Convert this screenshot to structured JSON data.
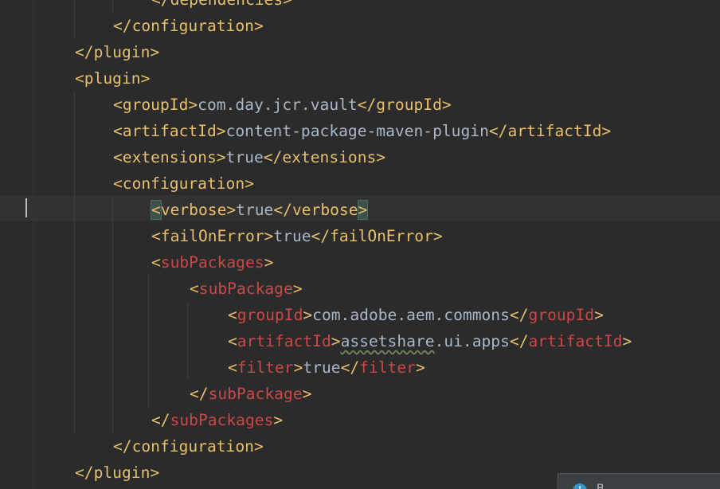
{
  "editor": {
    "language": "xml",
    "lines": [
      {
        "indent": 4,
        "tokens": [
          {
            "t": "</dependencies>",
            "c": "tag"
          }
        ]
      },
      {
        "indent": 3,
        "tokens": [
          {
            "t": "</configuration>",
            "c": "tag"
          }
        ]
      },
      {
        "indent": 2,
        "tokens": [
          {
            "t": "</plugin>",
            "c": "tag"
          }
        ]
      },
      {
        "indent": 2,
        "tokens": [
          {
            "t": "<plugin>",
            "c": "tag"
          }
        ]
      },
      {
        "indent": 3,
        "tokens": [
          {
            "t": "<groupId>",
            "c": "tag"
          },
          {
            "t": "com.day.jcr.vault",
            "c": "text"
          },
          {
            "t": "</groupId>",
            "c": "tag"
          }
        ]
      },
      {
        "indent": 3,
        "tokens": [
          {
            "t": "<artifactId>",
            "c": "tag"
          },
          {
            "t": "content-package-maven-plugin",
            "c": "text"
          },
          {
            "t": "</artifactId>",
            "c": "tag"
          }
        ]
      },
      {
        "indent": 3,
        "tokens": [
          {
            "t": "<extensions>",
            "c": "tag"
          },
          {
            "t": "true",
            "c": "text"
          },
          {
            "t": "</extensions>",
            "c": "tag"
          }
        ]
      },
      {
        "indent": 3,
        "tokens": [
          {
            "t": "<configuration>",
            "c": "tag"
          }
        ]
      },
      {
        "indent": 4,
        "current": true,
        "tokens": [
          {
            "t": "<",
            "c": "tag match"
          },
          {
            "t": "verbose>",
            "c": "tag"
          },
          {
            "t": "true",
            "c": "text"
          },
          {
            "t": "</verbose",
            "c": "tag"
          },
          {
            "t": ">",
            "c": "tag match"
          }
        ]
      },
      {
        "indent": 4,
        "tokens": [
          {
            "t": "<failOnError>",
            "c": "tag"
          },
          {
            "t": "true",
            "c": "text"
          },
          {
            "t": "</failOnError>",
            "c": "tag"
          }
        ]
      },
      {
        "indent": 4,
        "tokens": [
          {
            "t": "<",
            "c": "tag"
          },
          {
            "t": "subPackages",
            "c": "tag-red"
          },
          {
            "t": ">",
            "c": "tag"
          }
        ]
      },
      {
        "indent": 5,
        "tokens": [
          {
            "t": "<",
            "c": "tag"
          },
          {
            "t": "subPackage",
            "c": "tag-red"
          },
          {
            "t": ">",
            "c": "tag"
          }
        ]
      },
      {
        "indent": 6,
        "tokens": [
          {
            "t": "<",
            "c": "tag"
          },
          {
            "t": "groupId",
            "c": "tag-red"
          },
          {
            "t": ">",
            "c": "tag"
          },
          {
            "t": "com.adobe.aem.commons",
            "c": "text"
          },
          {
            "t": "</",
            "c": "tag"
          },
          {
            "t": "groupId",
            "c": "tag-red"
          },
          {
            "t": ">",
            "c": "tag"
          }
        ]
      },
      {
        "indent": 6,
        "tokens": [
          {
            "t": "<",
            "c": "tag"
          },
          {
            "t": "artifactId",
            "c": "tag-red"
          },
          {
            "t": ">",
            "c": "tag"
          },
          {
            "t": "assetshare",
            "c": "text typo"
          },
          {
            "t": ".ui.apps",
            "c": "text"
          },
          {
            "t": "</",
            "c": "tag"
          },
          {
            "t": "artifactId",
            "c": "tag-red"
          },
          {
            "t": ">",
            "c": "tag"
          }
        ]
      },
      {
        "indent": 6,
        "tokens": [
          {
            "t": "<",
            "c": "tag"
          },
          {
            "t": "filter",
            "c": "tag-red"
          },
          {
            "t": ">",
            "c": "tag"
          },
          {
            "t": "true",
            "c": "text"
          },
          {
            "t": "</",
            "c": "tag"
          },
          {
            "t": "filter",
            "c": "tag-red"
          },
          {
            "t": ">",
            "c": "tag"
          }
        ]
      },
      {
        "indent": 5,
        "tokens": [
          {
            "t": "</",
            "c": "tag"
          },
          {
            "t": "subPackage",
            "c": "tag-red"
          },
          {
            "t": ">",
            "c": "tag"
          }
        ]
      },
      {
        "indent": 4,
        "tokens": [
          {
            "t": "</",
            "c": "tag"
          },
          {
            "t": "subPackages",
            "c": "tag-red"
          },
          {
            "t": ">",
            "c": "tag"
          }
        ]
      },
      {
        "indent": 3,
        "tokens": [
          {
            "t": "</configuration>",
            "c": "tag"
          }
        ]
      },
      {
        "indent": 2,
        "tokens": [
          {
            "t": "</plugin>",
            "c": "tag"
          }
        ]
      }
    ]
  },
  "notification": {
    "icon": "info-icon",
    "text": "B"
  },
  "colors": {
    "background": "#2b2b2b",
    "tag": "#e8bf6a",
    "unresolved_tag": "#cc4747",
    "text": "#a9b7c6",
    "current_line": "#323232",
    "brace_match": "#3b514d"
  }
}
